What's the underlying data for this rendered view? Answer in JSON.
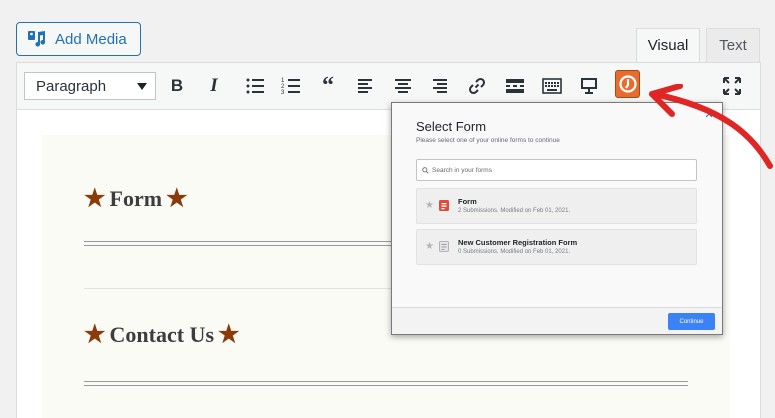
{
  "header": {
    "add_media_label": "Add Media",
    "tabs": [
      {
        "label": "Visual",
        "active": true
      },
      {
        "label": "Text",
        "active": false
      }
    ]
  },
  "toolbar": {
    "format_value": "Paragraph",
    "bold_glyph": "B",
    "italic_glyph": "I",
    "quote_glyph": "“",
    "buttons": [
      "bold-icon",
      "italic-icon",
      "bulleted-list-icon",
      "numbered-list-icon",
      "blockquote-icon",
      "align-left-icon",
      "align-center-icon",
      "align-right-icon",
      "link-icon",
      "read-more-icon",
      "toolbar-toggle-icon",
      "preview-icon",
      "formidable-forms-icon",
      "fullscreen-icon"
    ],
    "accent_color": "#e86c2d"
  },
  "content": {
    "headings": [
      "Form",
      "Contact Us"
    ],
    "star_glyph": "★",
    "star_color": "#8b3a0a"
  },
  "popup": {
    "title": "Select Form",
    "subtitle": "Please select one of your online forms to continue",
    "search_placeholder": "Search in your forms",
    "close_glyph": "✕",
    "forms": [
      {
        "name": "Form",
        "meta": "2 Submissions. Modified on Feb 01, 2021.",
        "icon": "form-red-icon"
      },
      {
        "name": "New Customer Registration Form",
        "meta": "0 Submissions. Modified on Feb 01, 2021.",
        "icon": "form-gray-icon"
      }
    ],
    "continue_label": "Continue",
    "button_color": "#3b82f6"
  },
  "annotation": {
    "arrow_color": "#e02525"
  }
}
